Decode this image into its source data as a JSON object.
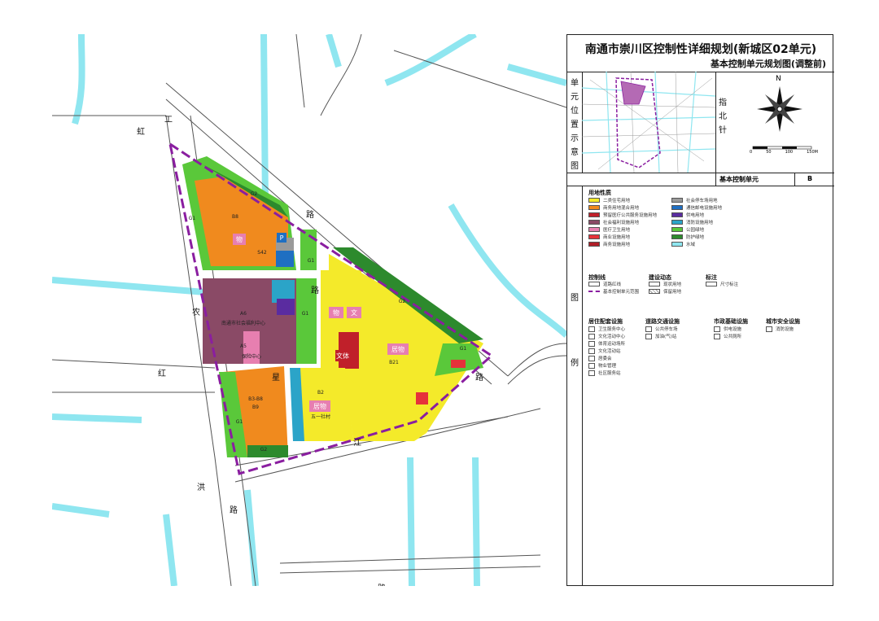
{
  "title": "南通市崇川区控制性详细规划(新城区02单元)",
  "subtitle": "基本控制单元规划图(调整前)",
  "side_label_chars": [
    "单",
    "元",
    "位",
    "置",
    "示",
    "意",
    "图"
  ],
  "compass": {
    "n_label": "N",
    "side_chars": [
      "指",
      "北",
      "针"
    ],
    "scale_ticks": [
      "0",
      "50",
      "100",
      "150M"
    ]
  },
  "unit_row": {
    "label": "基本控制单元",
    "value": "B"
  },
  "legend_chars": [
    "图",
    "例"
  ],
  "landuse": {
    "heading": "用地性质",
    "left": [
      {
        "label": "二类住宅用地",
        "color": "#f4ea2a"
      },
      {
        "label": "商务用地混合用地",
        "color": "#f08a1e"
      },
      {
        "label": "预留医疗公共服务设施用地",
        "color": "#c0202a"
      },
      {
        "label": "社会福利设施用地",
        "color": "#8a4a66"
      },
      {
        "label": "医疗卫生用地",
        "color": "#e77fb0"
      },
      {
        "label": "商业设施用地",
        "color": "#e6323a"
      },
      {
        "label": "商务设施用地",
        "color": "#b01e28"
      }
    ],
    "right": [
      {
        "label": "社会停车场用地",
        "color": "#9a9a9a"
      },
      {
        "label": "通信邮电设施用地",
        "color": "#1f6fc2"
      },
      {
        "label": "供电用地",
        "color": "#5a2ca0"
      },
      {
        "label": "消防设施用地",
        "color": "#2ba4c8"
      },
      {
        "label": "公园绿地",
        "color": "#5ac83a"
      },
      {
        "label": "防护绿地",
        "color": "#2d8a2d"
      },
      {
        "label": "水域",
        "color": "#8fe6f0"
      }
    ]
  },
  "control": {
    "heading": "控制线",
    "items": [
      "道路红线",
      "基本控制单元范围"
    ],
    "build_heading": "建设动态",
    "build_items": [
      "现状用地",
      "保留用地"
    ],
    "note_heading": "标注",
    "note_items": [
      "尺寸标注"
    ]
  },
  "facilities": {
    "col1_heading": "居住配套设施",
    "col1": [
      "卫生服务中心",
      "文化活动中心",
      "体育运动场所",
      "文化活动站",
      "居委会",
      "物业管理",
      "社区服务站"
    ],
    "col2_heading": "道路交通设施",
    "col2": [
      "公共停车场",
      "加油(气)站"
    ],
    "col3_heading": "市政基础设施",
    "col3": [
      "供电设施",
      "公共厕所"
    ],
    "col4_heading": "城市安全设施",
    "col4": [
      "消防设施"
    ]
  },
  "map_labels": {
    "block_labels": [
      "B8",
      "B5",
      "A6",
      "A5",
      "B3-B8",
      "B9",
      "B21",
      "B2",
      "G1",
      "G2",
      "S42"
    ],
    "named": [
      "南通市社会福利中心",
      "保险中心",
      "五一社村"
    ],
    "icon_texts": [
      "物",
      "物",
      "文",
      "文体",
      "居物",
      "居物",
      "P"
    ]
  },
  "roads": {
    "gonghong": [
      "工",
      "虹"
    ],
    "hongxing": [
      "洪",
      "路"
    ],
    "nongyuan": [
      "农"
    ],
    "hong": [
      "红"
    ],
    "xing": [
      "星"
    ],
    "jiang": [
      "江"
    ],
    "yanhe_road": [
      "沿",
      "河",
      "路"
    ],
    "diao": [
      "路",
      "路"
    ],
    "zhong": [
      "路"
    ]
  }
}
